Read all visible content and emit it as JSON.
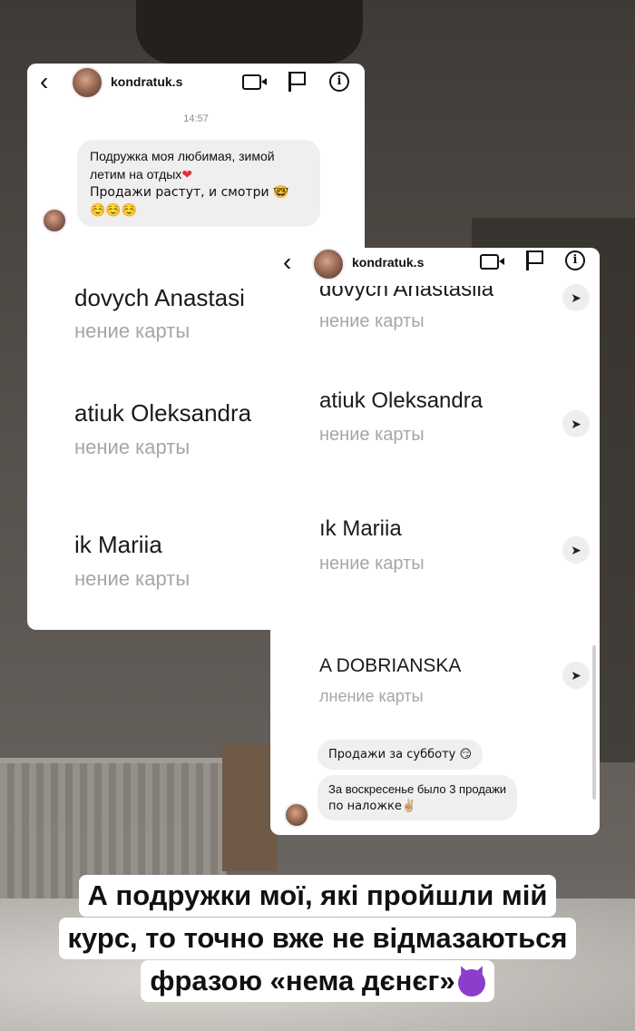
{
  "screenshot1": {
    "username": "kondratuk.s",
    "timestamp": "14:57",
    "message_lines": [
      "Подружка моя любимая, зимой",
      "летим на отдых",
      "Продажи растут, и смотри 🤓",
      "☺️☺️☺️"
    ],
    "heart": "❤",
    "icons": [
      "back-icon",
      "video-call-icon",
      "flag-icon",
      "info-icon"
    ],
    "cards": [
      {
        "name": "dovych Anastasi",
        "subtitle": "нение карты"
      },
      {
        "name": "atiuk Oleksandra",
        "subtitle": "нение карты"
      },
      {
        "name": "ik Mariia",
        "subtitle": "нение карты"
      }
    ]
  },
  "screenshot2": {
    "username": "kondratuk.s",
    "cards": [
      {
        "name": "dovych Anastasiia",
        "subtitle": "нение карты"
      },
      {
        "name": "atiuk Oleksandra",
        "subtitle": "нение карты"
      },
      {
        "name": "ık Mariia",
        "subtitle": "нение карты"
      },
      {
        "name": "A DOBRIANSKA",
        "subtitle": "лнение карты"
      }
    ],
    "message1": "Продажи за субботу 😏",
    "message2_lines": [
      "За воскресенье было 3 продажи",
      "по наложке✌🏼"
    ]
  },
  "caption": {
    "lines": [
      "А подружки мої, які пройшли мій",
      "курс, то точно вже не відмазаються",
      "фразою «нема дєнєг»"
    ],
    "emoji": "devil-emoji"
  }
}
